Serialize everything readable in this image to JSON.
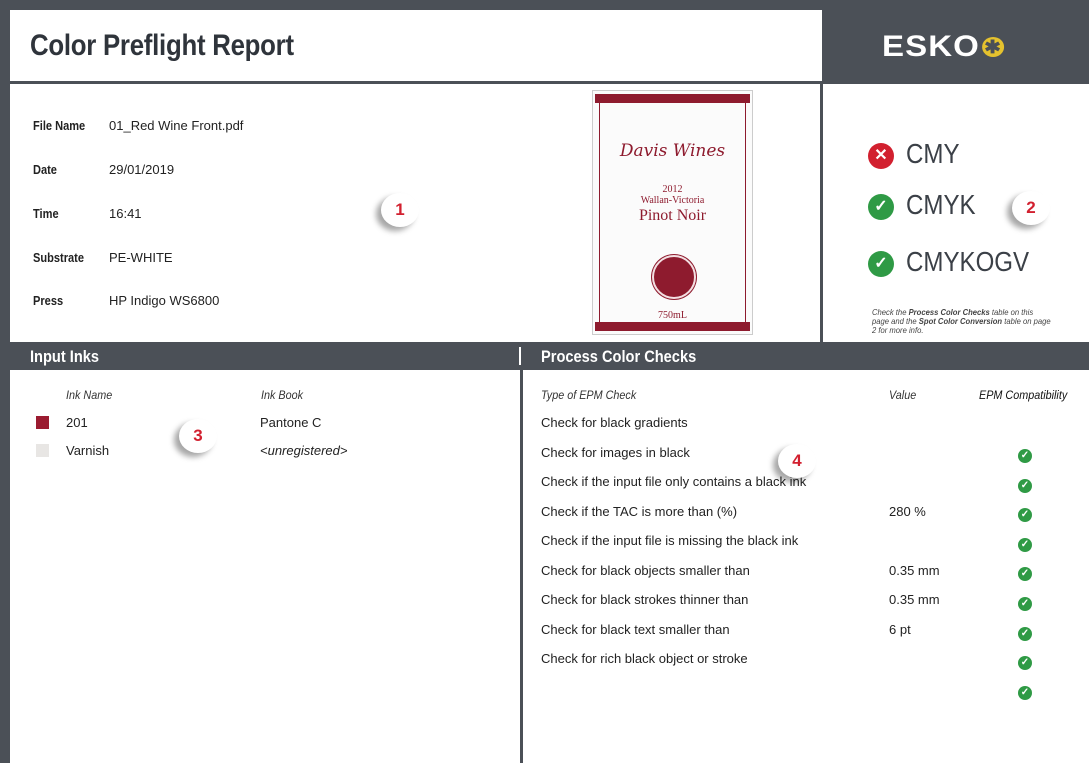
{
  "header": {
    "title": "Color Preflight Report",
    "logo_text": "ESKO",
    "logo_icon": "asterisk-icon"
  },
  "file_info": [
    {
      "label": "File Name",
      "value": "01_Red Wine Front.pdf"
    },
    {
      "label": "Date",
      "value": "29/01/2019"
    },
    {
      "label": "Time",
      "value": "16:41"
    },
    {
      "label": "Substrate",
      "value": "PE-WHITE"
    },
    {
      "label": "Press",
      "value": "HP Indigo WS6800"
    }
  ],
  "callouts": [
    "1",
    "2",
    "3",
    "4"
  ],
  "label_image": {
    "brand": "Davis Wines",
    "year": "2012",
    "region": "Wallan-Victoria",
    "variety": "Pinot Noir",
    "volume": "750mL",
    "color": "#8e1b2e"
  },
  "compatibility": [
    {
      "label": "CMY",
      "status": "fail",
      "icon": "x-icon",
      "color": "#d2202f"
    },
    {
      "label": "CMYK",
      "status": "pass",
      "icon": "check-icon",
      "color": "#2f9a45"
    },
    {
      "label": "CMYKOGV",
      "status": "pass",
      "icon": "check-icon",
      "color": "#2f9a45"
    }
  ],
  "compat_note": {
    "part1": "Check the ",
    "bold1": "Process Color Checks",
    "part2": " table on this page and the ",
    "bold2": "Spot Color Conversion",
    "part3": " table on page 2 for more info."
  },
  "input_inks": {
    "title": "Input Inks",
    "col_name": "Ink Name",
    "col_book": "Ink Book",
    "rows": [
      {
        "name": "201",
        "book": "Pantone C",
        "swatch": "#9b1b30"
      },
      {
        "name": "Varnish",
        "book": "<unregistered>",
        "swatch": "#e8e6e4"
      }
    ]
  },
  "process_checks": {
    "title": "Process Color Checks",
    "col_type": "Type of EPM Check",
    "col_value": "Value",
    "col_compat": "EPM Compatibility",
    "rows": [
      {
        "name": "Check for black gradients",
        "value": ""
      },
      {
        "name": "Check for images in black",
        "value": ""
      },
      {
        "name": "Check if the input file only contains a black ink",
        "value": ""
      },
      {
        "name": "Check if the TAC is more than (%)",
        "value": "280 %"
      },
      {
        "name": "Check if the input file is missing the black ink",
        "value": ""
      },
      {
        "name": "Check for black objects smaller than",
        "value": "0.35 mm"
      },
      {
        "name": "Check for black strokes thinner than",
        "value": "0.35 mm"
      },
      {
        "name": "Check for black text smaller than",
        "value": "6 pt"
      },
      {
        "name": "Check for rich black object or stroke",
        "value": ""
      }
    ],
    "compat_marks": [
      "pass",
      "pass",
      "pass",
      "pass",
      "pass",
      "pass",
      "pass",
      "pass",
      "pass"
    ]
  }
}
